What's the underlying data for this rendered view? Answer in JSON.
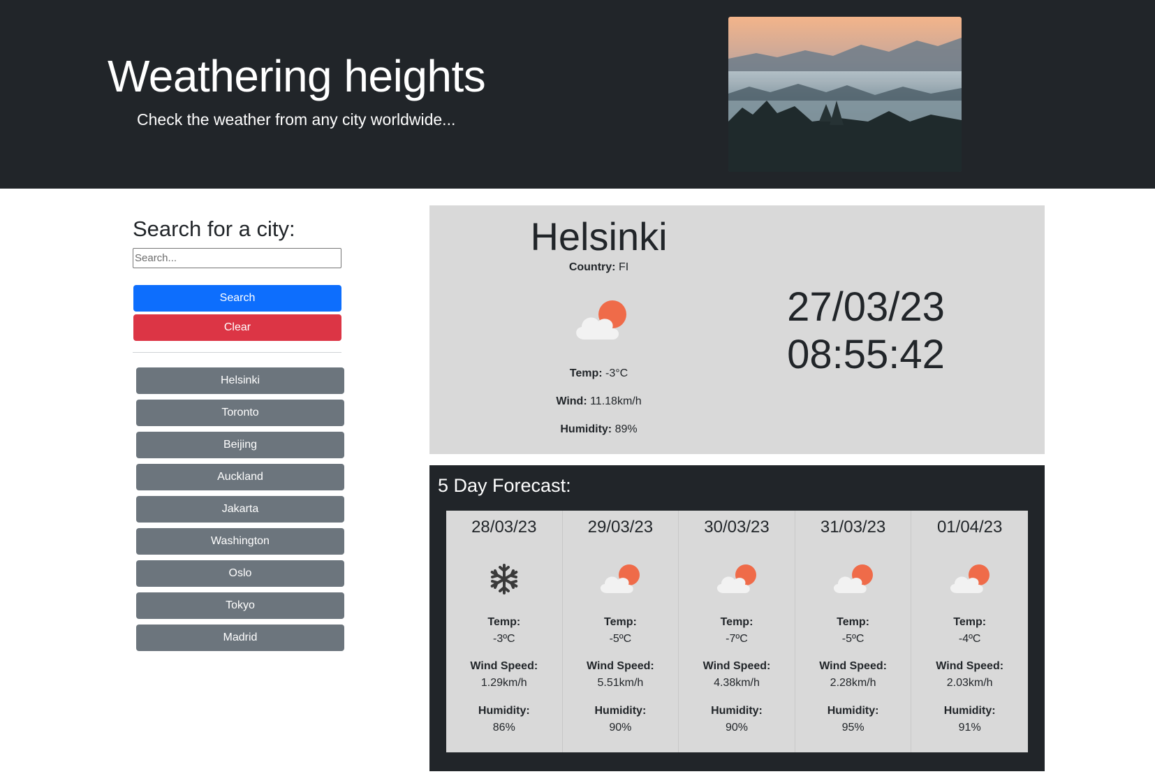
{
  "header": {
    "title": "Weathering heights",
    "subtitle": "Check the weather from any city worldwide...",
    "hero_image": "misty-mountains-sunrise-photo"
  },
  "sidebar": {
    "heading": "Search for a city:",
    "search_placeholder": "Search...",
    "search_value": "",
    "search_label": "Search",
    "clear_label": "Clear",
    "cities": [
      "Helsinki",
      "Toronto",
      "Beijing",
      "Auckland",
      "Jakarta",
      "Washington",
      "Oslo",
      "Tokyo",
      "Madrid"
    ]
  },
  "current": {
    "city": "Helsinki",
    "country_label": "Country:",
    "country": "FI",
    "icon": "partly-cloudy-icon",
    "temp_label": "Temp:",
    "temp": "-3°C",
    "wind_label": "Wind:",
    "wind": "11.18km/h",
    "humidity_label": "Humidity:",
    "humidity": "89%",
    "date": "27/03/23",
    "time": "08:55:42"
  },
  "forecast": {
    "heading": "5 Day Forecast:",
    "temp_label": "Temp:",
    "wind_label": "Wind Speed:",
    "humidity_label": "Humidity:",
    "days": [
      {
        "date": "28/03/23",
        "icon": "snowflake-icon",
        "temp": "-3ºC",
        "wind": "1.29km/h",
        "humidity": "86%"
      },
      {
        "date": "29/03/23",
        "icon": "partly-cloudy-icon",
        "temp": "-5ºC",
        "wind": "5.51km/h",
        "humidity": "90%"
      },
      {
        "date": "30/03/23",
        "icon": "partly-cloudy-icon",
        "temp": "-7ºC",
        "wind": "4.38km/h",
        "humidity": "90%"
      },
      {
        "date": "31/03/23",
        "icon": "partly-cloudy-icon",
        "temp": "-5ºC",
        "wind": "2.28km/h",
        "humidity": "95%"
      },
      {
        "date": "01/04/23",
        "icon": "partly-cloudy-icon",
        "temp": "-4ºC",
        "wind": "2.03km/h",
        "humidity": "91%"
      }
    ]
  },
  "colors": {
    "header_bg": "#212529",
    "search_button": "#0d6efd",
    "clear_button": "#dc3545",
    "city_button": "#6c757d",
    "panel_bg": "#d9d9d9",
    "sun": "#ef6b49"
  }
}
